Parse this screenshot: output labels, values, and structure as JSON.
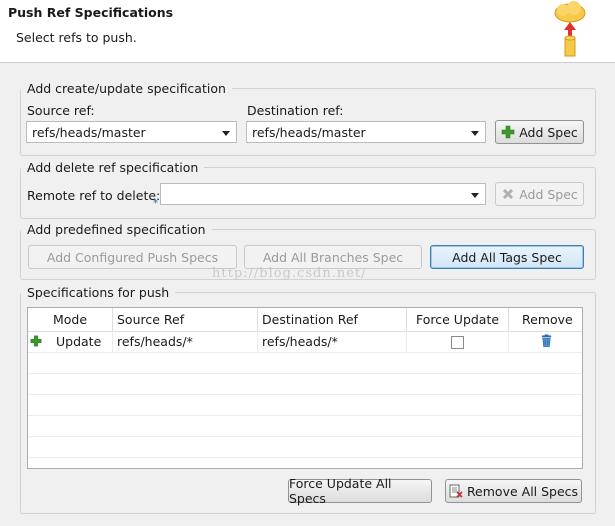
{
  "header": {
    "title": "Push Ref Specifications",
    "subtitle": "Select refs to push."
  },
  "create_group": {
    "title": "Add create/update specification",
    "source_label": "Source ref:",
    "source_value": "refs/heads/master",
    "dest_label": "Destination ref:",
    "dest_value": "refs/heads/master",
    "add_button": "Add Spec"
  },
  "delete_group": {
    "title": "Add delete ref specification",
    "remote_label": "Remote ref to delete:",
    "remote_value": "",
    "add_button": "Add Spec"
  },
  "predefined_group": {
    "title": "Add predefined specification",
    "btn_configured": "Add Configured Push Specs",
    "btn_branches": "Add All Branches Spec",
    "btn_tags": "Add All Tags Spec"
  },
  "specs_group": {
    "title": "Specifications for push",
    "columns": [
      "Mode",
      "Source Ref",
      "Destination Ref",
      "Force Update",
      "Remove"
    ],
    "rows": [
      {
        "mode": "Update",
        "source": "refs/heads/*",
        "dest": "refs/heads/*",
        "force": false
      }
    ]
  },
  "footer": {
    "force_all": "Force Update All Specs",
    "remove_all": "Remove All Specs"
  },
  "watermark": "http://blog.csdn.net/",
  "colors": {
    "plus_green": "#3a9a2a",
    "trash_blue": "#2a6db5",
    "focus_border": "#3c7fb1"
  }
}
